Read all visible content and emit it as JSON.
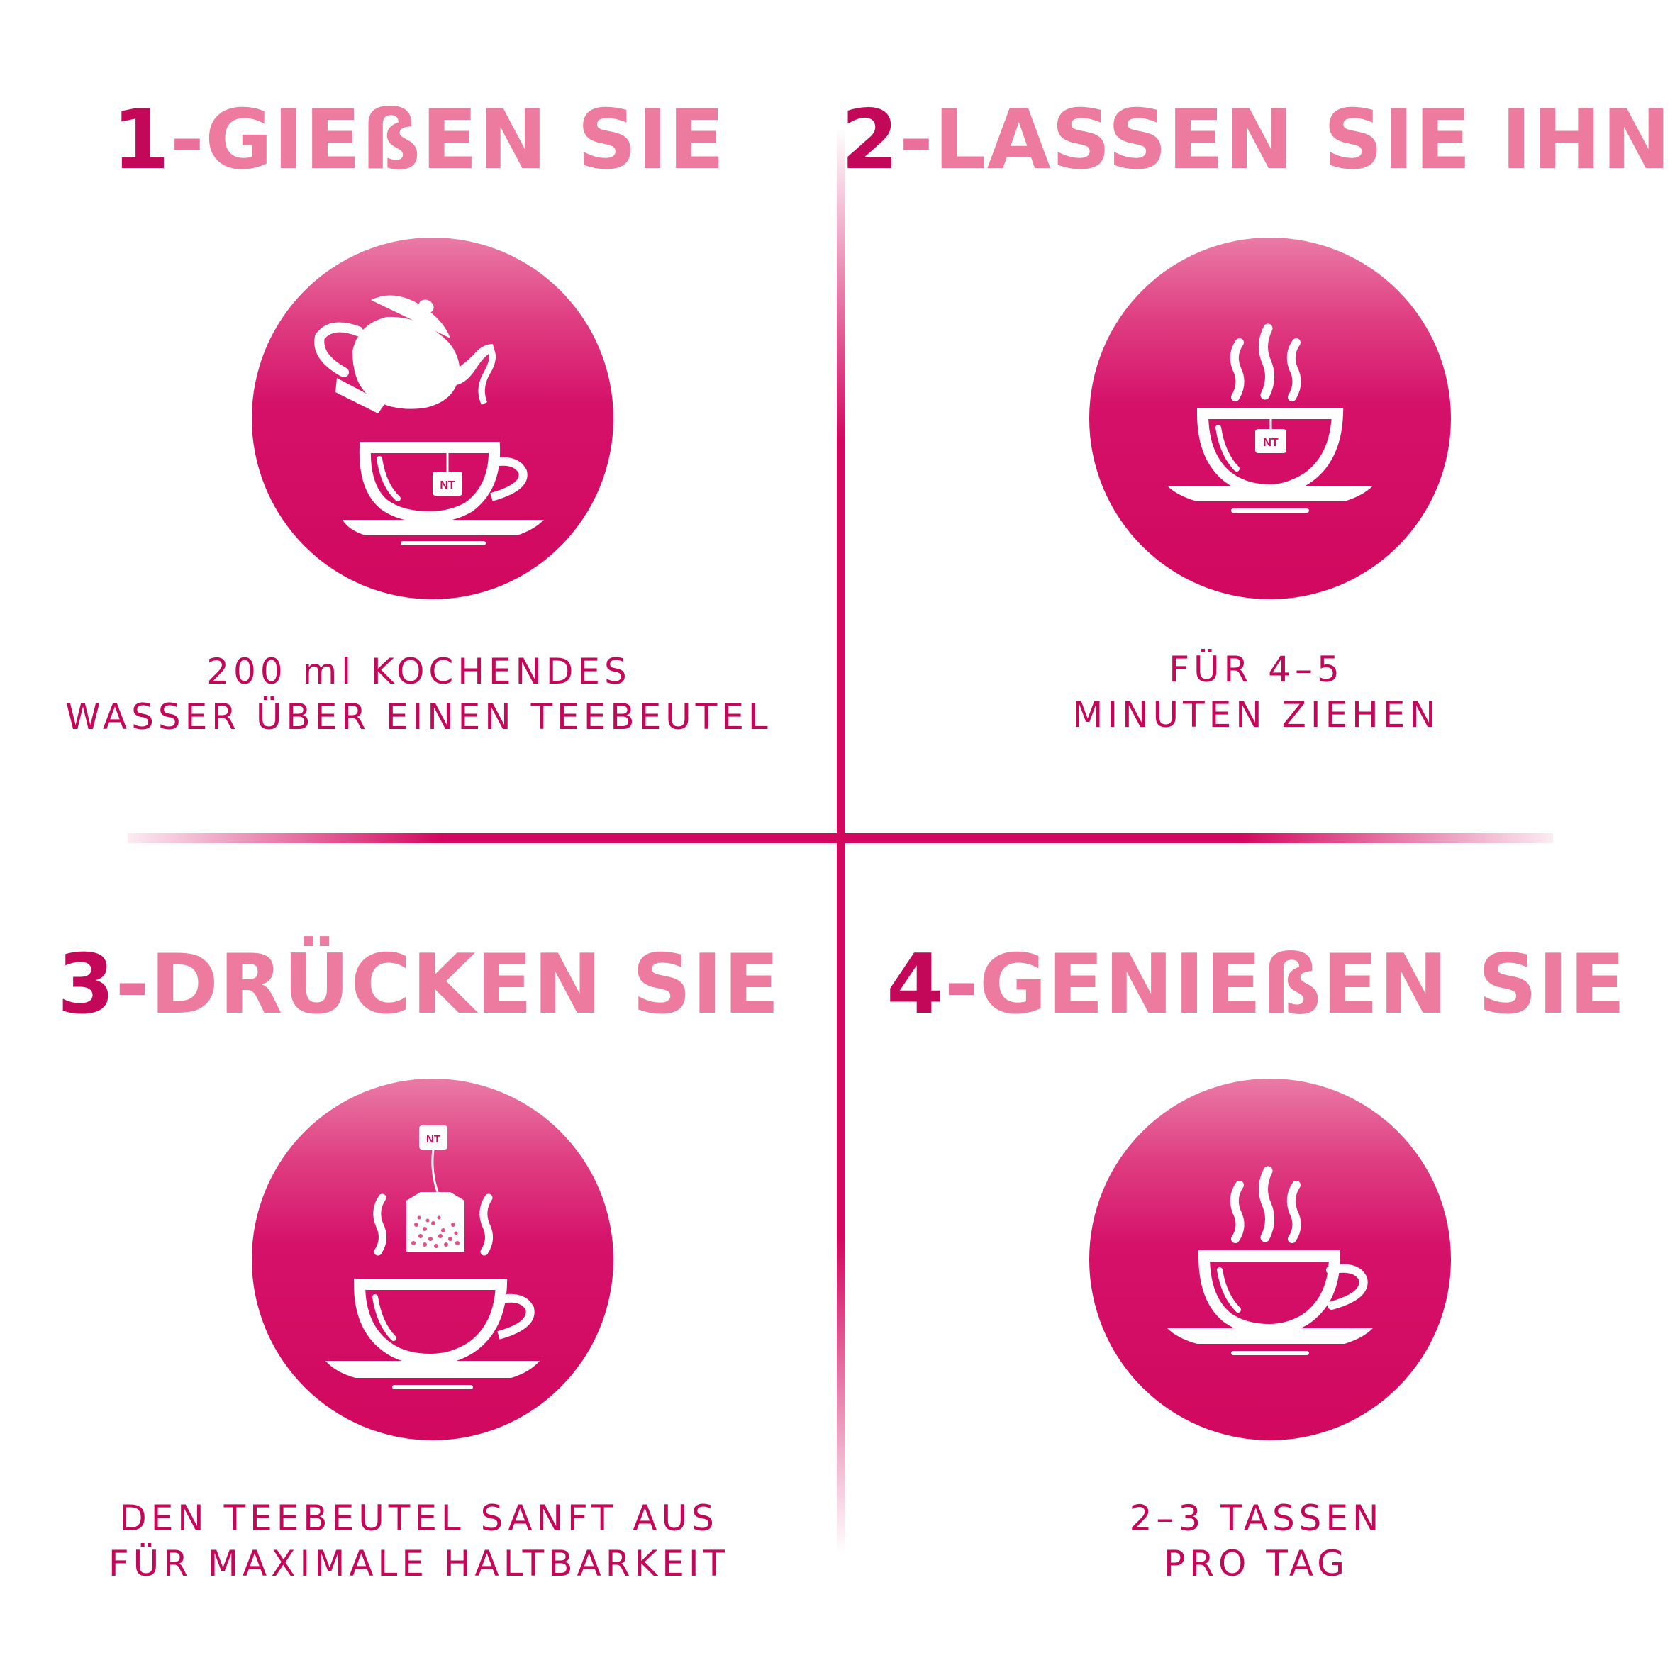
{
  "colors": {
    "number": "#c3085a",
    "word": "#ec7b9f",
    "line": "#d1085e",
    "circle_top": "#ea7ba6",
    "circle_bottom": "#d1085e",
    "text": "#c3085a"
  },
  "steps": [
    {
      "number": "1",
      "separator": "-",
      "title": "GIEßEN SIE",
      "icon": "teapot-pouring-into-cup-icon",
      "tag_label": "NT",
      "description": [
        "200 ml KOCHENDES",
        "WASSER ÜBER EINEN TEEBEUTEL"
      ]
    },
    {
      "number": "2",
      "separator": "-",
      "title": "LASSEN SIE IHN",
      "icon": "steaming-cup-with-teabag-icon",
      "tag_label": "NT",
      "description": [
        "FÜR 4–5",
        "MINUTEN ZIEHEN"
      ]
    },
    {
      "number": "3",
      "separator": "-",
      "title": "DRÜCKEN SIE",
      "icon": "teabag-over-cup-icon",
      "tag_label": "NT",
      "description": [
        "DEN TEEBEUTEL SANFT AUS",
        "FÜR MAXIMALE HALTBARKEIT"
      ]
    },
    {
      "number": "4",
      "separator": "-",
      "title": "GENIEßEN SIE",
      "icon": "steaming-cup-icon",
      "description": [
        "2–3 TASSEN",
        "PRO TAG"
      ]
    }
  ]
}
